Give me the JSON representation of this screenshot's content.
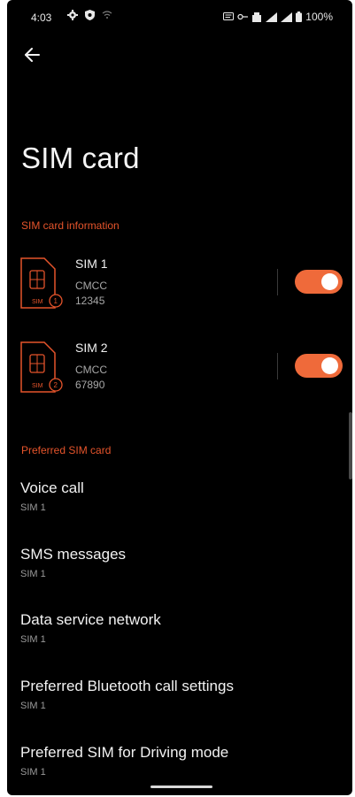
{
  "status_bar": {
    "time": "4:03",
    "battery": "100%"
  },
  "page": {
    "title": "SIM card"
  },
  "sections": {
    "sim_info_header": "SIM card information",
    "preferred_header": "Preferred SIM card"
  },
  "sims": [
    {
      "name": "SIM 1",
      "carrier": "CMCC",
      "number": "12345",
      "badge": "SIM",
      "badge_num": "1",
      "enabled": true
    },
    {
      "name": "SIM 2",
      "carrier": "CMCC",
      "number": "67890",
      "badge": "SIM",
      "badge_num": "2",
      "enabled": true
    }
  ],
  "preferred": [
    {
      "title": "Voice call",
      "value": "SIM 1"
    },
    {
      "title": "SMS messages",
      "value": "SIM 1"
    },
    {
      "title": "Data service network",
      "value": "SIM 1"
    },
    {
      "title": "Preferred Bluetooth call settings",
      "value": "SIM 1"
    },
    {
      "title": "Preferred SIM for Driving mode",
      "value": "SIM 1"
    }
  ],
  "colors": {
    "accent": "#ef6a3a",
    "section_header": "#e5542b",
    "background": "#000000"
  },
  "icons": {
    "back": "arrow-left-icon",
    "sim": "sim-card-icon"
  }
}
